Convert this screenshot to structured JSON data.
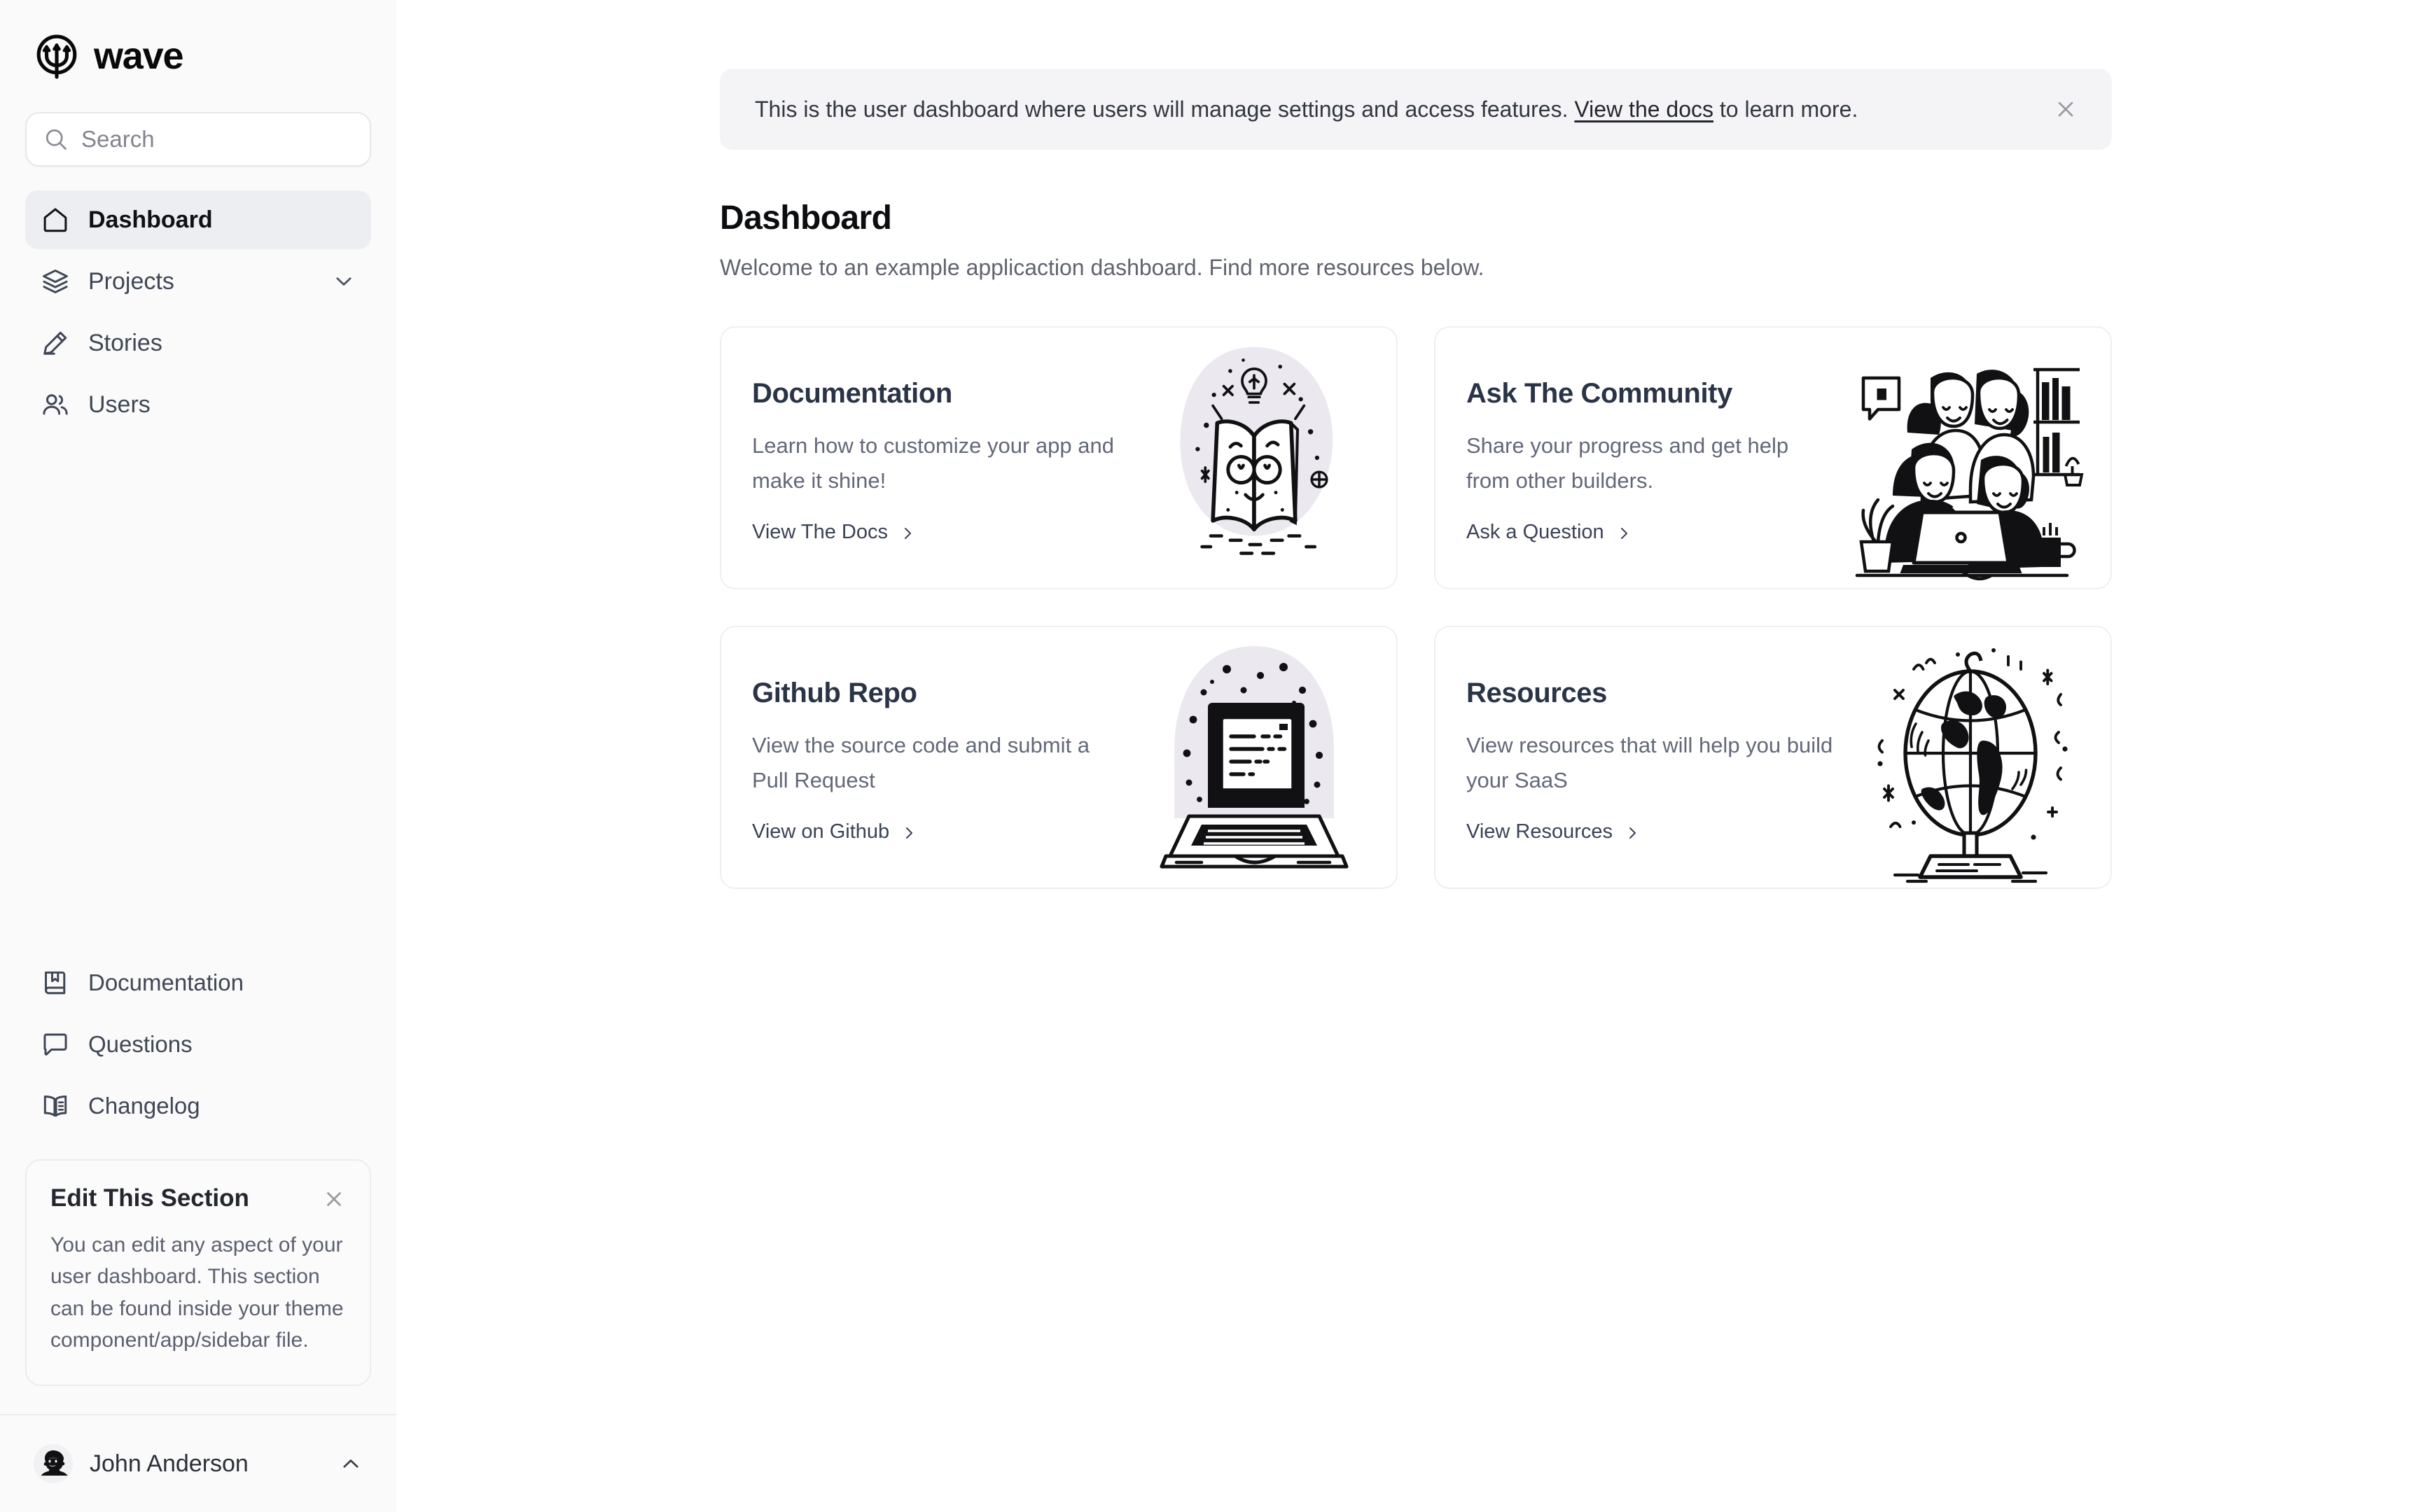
{
  "brand": {
    "name": "wave",
    "logo_icon": "trident-circle-logo"
  },
  "sidebar": {
    "search": {
      "placeholder": "Search",
      "value": "",
      "icon": "search-icon"
    },
    "nav_primary": [
      {
        "label": "Dashboard",
        "icon": "home-icon",
        "active": true
      },
      {
        "label": "Projects",
        "icon": "layers-icon",
        "active": false,
        "caret": "chevron-down-icon"
      },
      {
        "label": "Stories",
        "icon": "pencil-icon",
        "active": false
      },
      {
        "label": "Users",
        "icon": "users-icon",
        "active": false
      }
    ],
    "nav_secondary": [
      {
        "label": "Documentation",
        "icon": "bookmark-book-icon"
      },
      {
        "label": "Questions",
        "icon": "chat-bubble-icon"
      },
      {
        "label": "Changelog",
        "icon": "open-book-icon"
      }
    ],
    "edit_card": {
      "title": "Edit This Section",
      "body": "You can edit any aspect of your user dashboard. This section can be found inside your theme component/app/sidebar file.",
      "close_icon": "close-icon"
    },
    "user": {
      "name": "John Anderson",
      "avatar": "user-avatar",
      "caret": "chevron-up-icon"
    }
  },
  "main": {
    "alert": {
      "text_before": "This is the user dashboard where users will manage settings and access features. ",
      "link_label": "View the docs",
      "text_after": " to learn more.",
      "close_icon": "close-icon"
    },
    "page_title": "Dashboard",
    "page_subtitle": "Welcome to an example applicaction dashboard. Find more resources below.",
    "cards": [
      {
        "title": "Documentation",
        "description": "Learn how to customize your app and make it shine!",
        "link_label": "View The Docs",
        "art": "open-book-illustration"
      },
      {
        "title": "Ask The Community",
        "description": "Share your progress and get help from other builders.",
        "link_label": "Ask a Question",
        "art": "people-group-illustration"
      },
      {
        "title": "Github Repo",
        "description": "View the source code and submit a Pull Request",
        "link_label": "View on Github",
        "art": "laptop-illustration"
      },
      {
        "title": "Resources",
        "description": "View resources that will help you build your SaaS",
        "link_label": "View Resources",
        "art": "globe-illustration"
      }
    ]
  },
  "colors": {
    "sidebar_bg": "#fafafa",
    "main_bg": "#ffffff",
    "nav_active_bg": "#eceef2",
    "alert_bg": "#f4f4f7",
    "card_border": "#eeeff1",
    "card_title": "#2b3447",
    "body_text": "#63687a",
    "art_blob": "#ebe9ef"
  }
}
